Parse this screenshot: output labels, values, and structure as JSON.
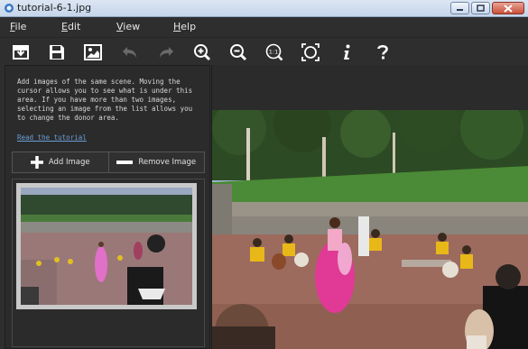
{
  "window": {
    "title": "tutorial-6-1.jpg"
  },
  "menu": [
    {
      "label": "File",
      "u": "F",
      "rest": "ile"
    },
    {
      "label": "Edit",
      "u": "E",
      "rest": "dit"
    },
    {
      "label": "View",
      "u": "V",
      "rest": "iew"
    },
    {
      "label": "Help",
      "u": "H",
      "rest": "elp"
    }
  ],
  "toolbar": {
    "icons": [
      "open-icon",
      "save-icon",
      "image-icon",
      "undo-icon",
      "redo-icon",
      "zoom-in-icon",
      "zoom-out-icon",
      "actual-size-icon",
      "fit-icon",
      "info-icon",
      "help-icon"
    ]
  },
  "panel": {
    "help_text": "Add images of the same scene. Moving the\ncursor allows you to see what is under this\narea. If you have more than two images,\nselecting an image from the list allows you\nto change the donor area.",
    "tutorial_link": "Read the tutorial",
    "add_image": "Add Image",
    "remove_image": "Remove Image"
  },
  "colors": {
    "accent_link": "#6a9fd8",
    "background": "#2e2e2e",
    "titlebar": "#c5d5ea"
  }
}
